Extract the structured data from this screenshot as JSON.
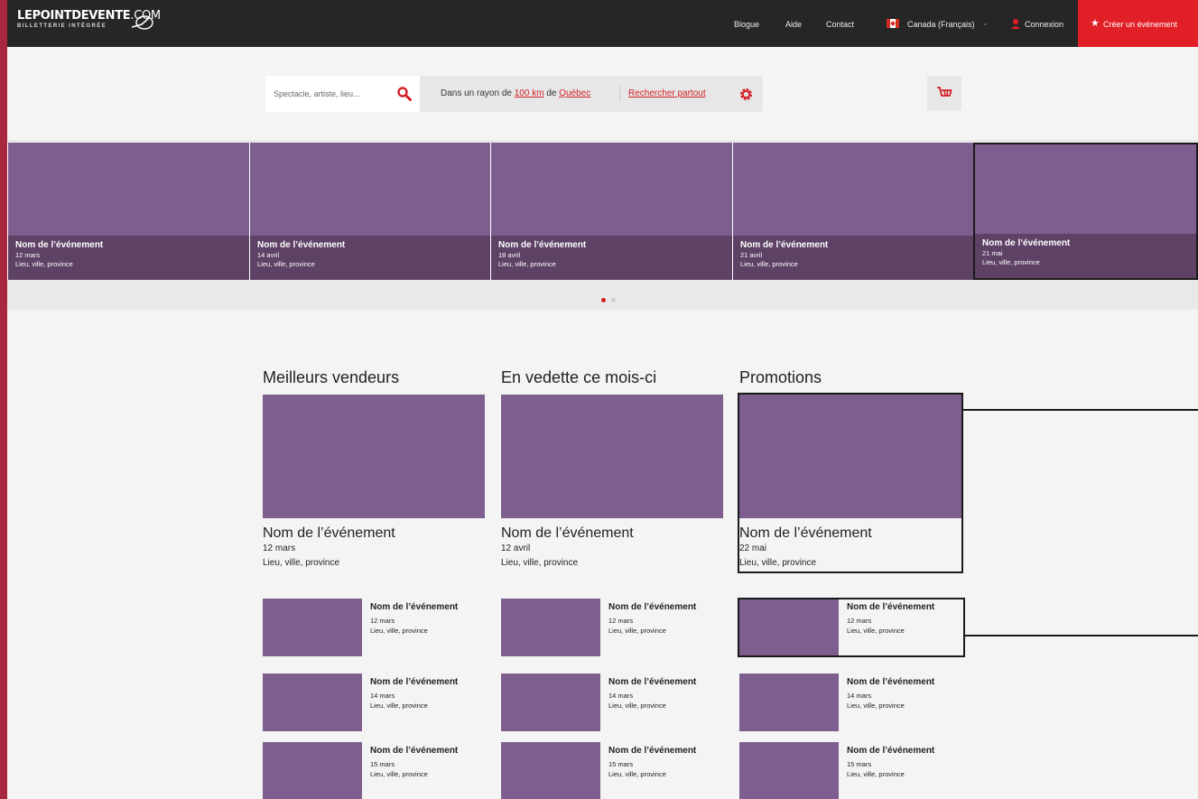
{
  "header": {
    "logo_main": "LEPOINTDEVENTE",
    "logo_suffix": ".COM",
    "logo_sub": "BILLETTERIE INTÉGRÉE",
    "nav": [
      "Blogue",
      "Aide",
      "Contact"
    ],
    "country": "Canada (Français)",
    "login": "Connexion",
    "create": "Créer un événement"
  },
  "search": {
    "placeholder": "Spectacle, artiste, lieu...",
    "radius_prefix": "Dans un rayon de",
    "radius_value": "100 km",
    "radius_mid": "de",
    "radius_city": "Québec",
    "anywhere": "Rechercher partout"
  },
  "carousel": {
    "slides": [
      {
        "title": "Nom de l’événement",
        "date": "12 mars",
        "location": "Lieu, ville, province"
      },
      {
        "title": "Nom de l’événement",
        "date": "14 avril",
        "location": "Lieu, ville, province"
      },
      {
        "title": "Nom de l’événement",
        "date": "18 avril",
        "location": "Lieu, ville, province"
      },
      {
        "title": "Nom de l’événement",
        "date": "21 avril",
        "location": "Lieu, ville, province"
      },
      {
        "title": "Nom de l’événement",
        "date": "21 mai",
        "location": "Lieu, ville, province"
      }
    ]
  },
  "sections": [
    {
      "heading": "Meilleurs vendeurs",
      "featured": {
        "title": "Nom de l’événement",
        "date": "12 mars",
        "location": "Lieu, ville, province"
      },
      "items": [
        {
          "title": "Nom de l’événement",
          "date": "12 mars",
          "location": "Lieu, ville, province"
        },
        {
          "title": "Nom de l’événement",
          "date": "14 mars",
          "location": "Lieu, ville, province"
        },
        {
          "title": "Nom de l’événement",
          "date": "15 mars",
          "location": "Lieu, ville, province"
        }
      ]
    },
    {
      "heading": "En vedette ce mois-ci",
      "featured": {
        "title": "Nom de l’événement",
        "date": "12 avril",
        "location": "Lieu, ville, province"
      },
      "items": [
        {
          "title": "Nom de l’événement",
          "date": "12 mars",
          "location": "Lieu, ville, province"
        },
        {
          "title": "Nom de l’événement",
          "date": "14 mars",
          "location": "Lieu, ville, province"
        },
        {
          "title": "Nom de l’événement",
          "date": "15 mars",
          "location": "Lieu, ville, province"
        }
      ]
    },
    {
      "heading": "Promotions",
      "featured": {
        "title": "Nom de l’événement",
        "date": "22 mai",
        "location": "Lieu, ville, province"
      },
      "items": [
        {
          "title": "Nom de l’événement",
          "date": "12 mars",
          "location": "Lieu, ville, province"
        },
        {
          "title": "Nom de l’événement",
          "date": "14 mars",
          "location": "Lieu, ville, province"
        },
        {
          "title": "Nom de l’événement",
          "date": "15 mars",
          "location": "Lieu, ville, province"
        }
      ]
    }
  ],
  "colors": {
    "accent": "#e01f26",
    "placeholder_image": "#7e5e8e",
    "topbar": "#262626"
  }
}
